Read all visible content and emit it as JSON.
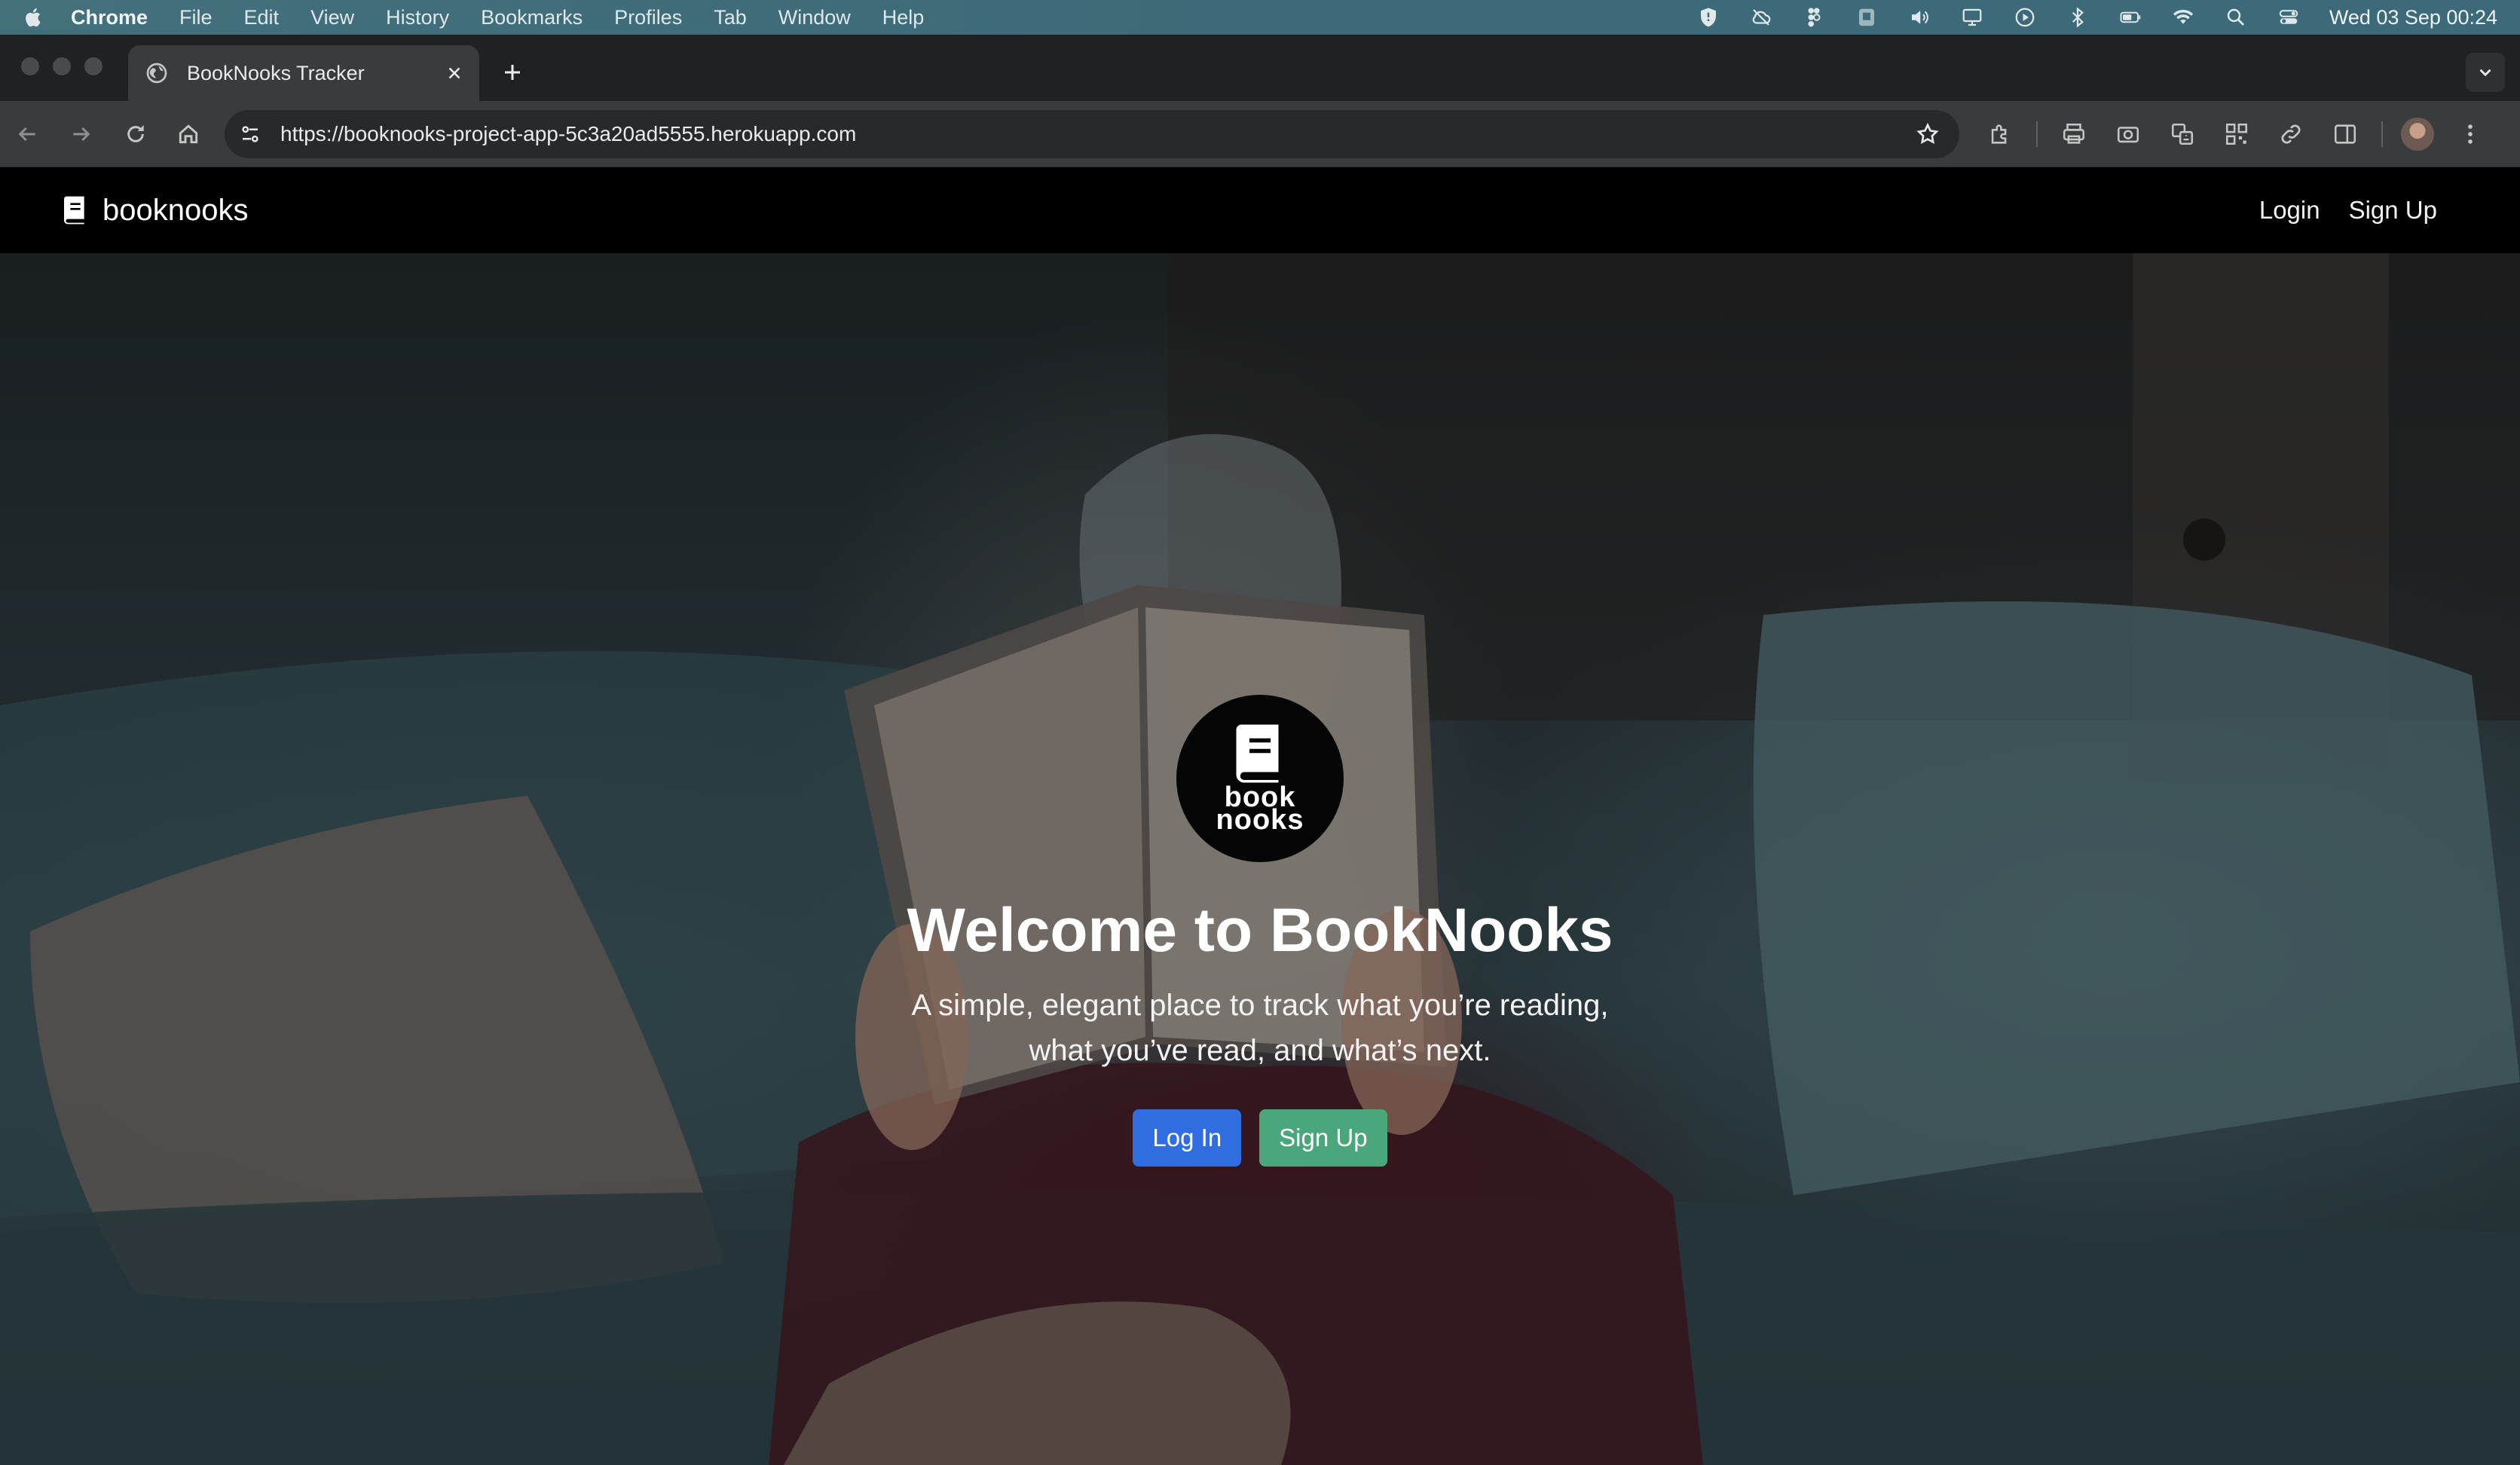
{
  "menubar": {
    "app_name": "Chrome",
    "items": [
      "File",
      "Edit",
      "View",
      "History",
      "Bookmarks",
      "Profiles",
      "Tab",
      "Window",
      "Help"
    ],
    "clock": "Wed 03 Sep  00:24"
  },
  "browser": {
    "tab_title": "BookNooks Tracker",
    "url": "https://booknooks-project-app-5c3a20ad5555.herokuapp.com"
  },
  "site": {
    "brand": "booknooks",
    "nav_login": "Login",
    "nav_signup": "Sign Up"
  },
  "hero": {
    "logo_line1": "book",
    "logo_line2": "nooks",
    "title": "Welcome to BookNooks",
    "subtitle_line1": "A simple, elegant place to track what you’re reading,",
    "subtitle_line2": "what you’ve read, and what’s next.",
    "login_button": "Log In",
    "signup_button": "Sign Up"
  },
  "colors": {
    "primary_button": "#2f6de0",
    "success_button": "#4aa77c",
    "navbar": "#000000"
  }
}
